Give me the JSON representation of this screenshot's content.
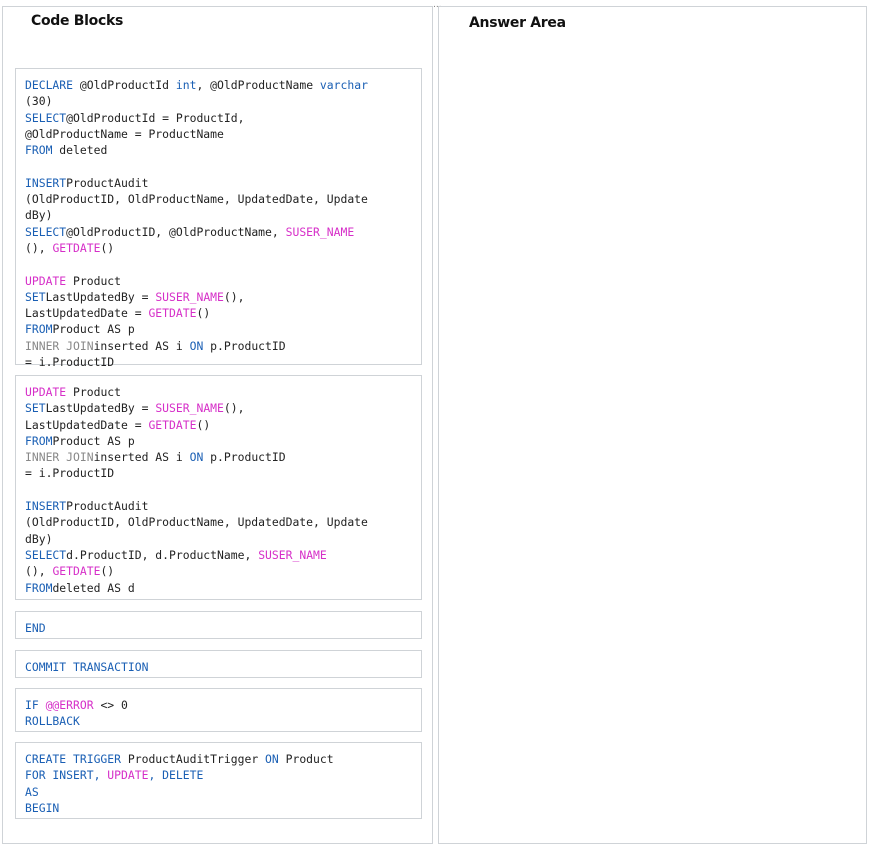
{
  "top_mark": "...",
  "left_title": "Code Blocks",
  "right_title": "Answer Area",
  "colors": {
    "keyword": "#1a5fb4",
    "function": "#d62fc8",
    "comment": "#888888",
    "text": "#222222"
  },
  "blocks": [
    {
      "lines": [
        [
          [
            "kw",
            "DECLARE"
          ],
          [
            "t",
            " @OldProductId "
          ],
          [
            "kw",
            "int"
          ],
          [
            "t",
            ", @OldProductName "
          ],
          [
            "kw",
            "varchar"
          ]
        ],
        [
          [
            "t",
            "(30)"
          ]
        ],
        [
          [
            "kw",
            "SELECT"
          ],
          [
            "t",
            "@OldProductId = ProductId,"
          ]
        ],
        [
          [
            "t",
            "@OldProductName = ProductName"
          ]
        ],
        [
          [
            "kw",
            "FROM"
          ],
          [
            "t",
            " deleted"
          ]
        ],
        [
          [
            "t",
            ""
          ]
        ],
        [
          [
            "kw",
            "INSERT"
          ],
          [
            "t",
            "ProductAudit"
          ]
        ],
        [
          [
            "t",
            "(OldProductID, OldProductName, UpdatedDate, Update"
          ]
        ],
        [
          [
            "t",
            "dBy)"
          ]
        ],
        [
          [
            "kw",
            "SELECT"
          ],
          [
            "t",
            "@OldProductID, @OldProductName, "
          ],
          [
            "fn",
            "SUSER_NAME"
          ]
        ],
        [
          [
            "t",
            "(), "
          ],
          [
            "fn",
            "GETDATE"
          ],
          [
            "t",
            "()"
          ]
        ],
        [
          [
            "t",
            ""
          ]
        ],
        [
          [
            "fn",
            "UPDATE"
          ],
          [
            "t",
            " Product"
          ]
        ],
        [
          [
            "kw",
            "SET"
          ],
          [
            "t",
            "LastUpdatedBy = "
          ],
          [
            "fn",
            "SUSER_NAME"
          ],
          [
            "t",
            "(),"
          ]
        ],
        [
          [
            "t",
            "LastUpdatedDate = "
          ],
          [
            "fn",
            "GETDATE"
          ],
          [
            "t",
            "()"
          ]
        ],
        [
          [
            "kw",
            "FROM"
          ],
          [
            "t",
            "Product AS p"
          ]
        ],
        [
          [
            "gr",
            "INNER JOIN"
          ],
          [
            "t",
            "inserted AS i "
          ],
          [
            "kw",
            "ON"
          ],
          [
            "t",
            " p.ProductID"
          ]
        ],
        [
          [
            "t",
            "= i.ProductID"
          ]
        ]
      ]
    },
    {
      "lines": [
        [
          [
            "fn",
            "UPDATE"
          ],
          [
            "t",
            " Product"
          ]
        ],
        [
          [
            "kw",
            "SET"
          ],
          [
            "t",
            "LastUpdatedBy = "
          ],
          [
            "fn",
            "SUSER_NAME"
          ],
          [
            "t",
            "(),"
          ]
        ],
        [
          [
            "t",
            "LastUpdatedDate = "
          ],
          [
            "fn",
            "GETDATE"
          ],
          [
            "t",
            "()"
          ]
        ],
        [
          [
            "kw",
            "FROM"
          ],
          [
            "t",
            "Product AS p"
          ]
        ],
        [
          [
            "gr",
            "INNER JOIN"
          ],
          [
            "t",
            "inserted AS i "
          ],
          [
            "kw",
            "ON"
          ],
          [
            "t",
            " p.ProductID"
          ]
        ],
        [
          [
            "t",
            "= i.ProductID"
          ]
        ],
        [
          [
            "t",
            ""
          ]
        ],
        [
          [
            "kw",
            "INSERT"
          ],
          [
            "t",
            "ProductAudit"
          ]
        ],
        [
          [
            "t",
            "(OldProductID, OldProductName, UpdatedDate, Update"
          ]
        ],
        [
          [
            "t",
            "dBy)"
          ]
        ],
        [
          [
            "kw",
            "SELECT"
          ],
          [
            "t",
            "d.ProductID, d.ProductName, "
          ],
          [
            "fn",
            "SUSER_NAME"
          ]
        ],
        [
          [
            "t",
            "(), "
          ],
          [
            "fn",
            "GETDATE"
          ],
          [
            "t",
            "()"
          ]
        ],
        [
          [
            "kw",
            "FROM"
          ],
          [
            "t",
            "deleted AS d"
          ]
        ]
      ]
    },
    {
      "lines": [
        [
          [
            "kw",
            "END"
          ]
        ]
      ]
    },
    {
      "lines": [
        [
          [
            "kw",
            "COMMIT TRANSACTION"
          ]
        ]
      ]
    },
    {
      "lines": [
        [
          [
            "kw",
            "IF "
          ],
          [
            "fn",
            "@@ERROR"
          ],
          [
            "t",
            " <> 0"
          ]
        ],
        [
          [
            "kw",
            "ROLLBACK"
          ]
        ]
      ]
    },
    {
      "lines": [
        [
          [
            "kw",
            "CREATE TRIGGER"
          ],
          [
            "t",
            " ProductAuditTrigger "
          ],
          [
            "kw",
            "ON"
          ],
          [
            "t",
            " Product"
          ]
        ],
        [
          [
            "kw",
            "FOR INSERT, "
          ],
          [
            "fn",
            "UPDATE"
          ],
          [
            "kw",
            ", DELETE"
          ]
        ],
        [
          [
            "kw",
            "AS"
          ]
        ],
        [
          [
            "kw",
            "BEGIN"
          ]
        ]
      ]
    }
  ]
}
